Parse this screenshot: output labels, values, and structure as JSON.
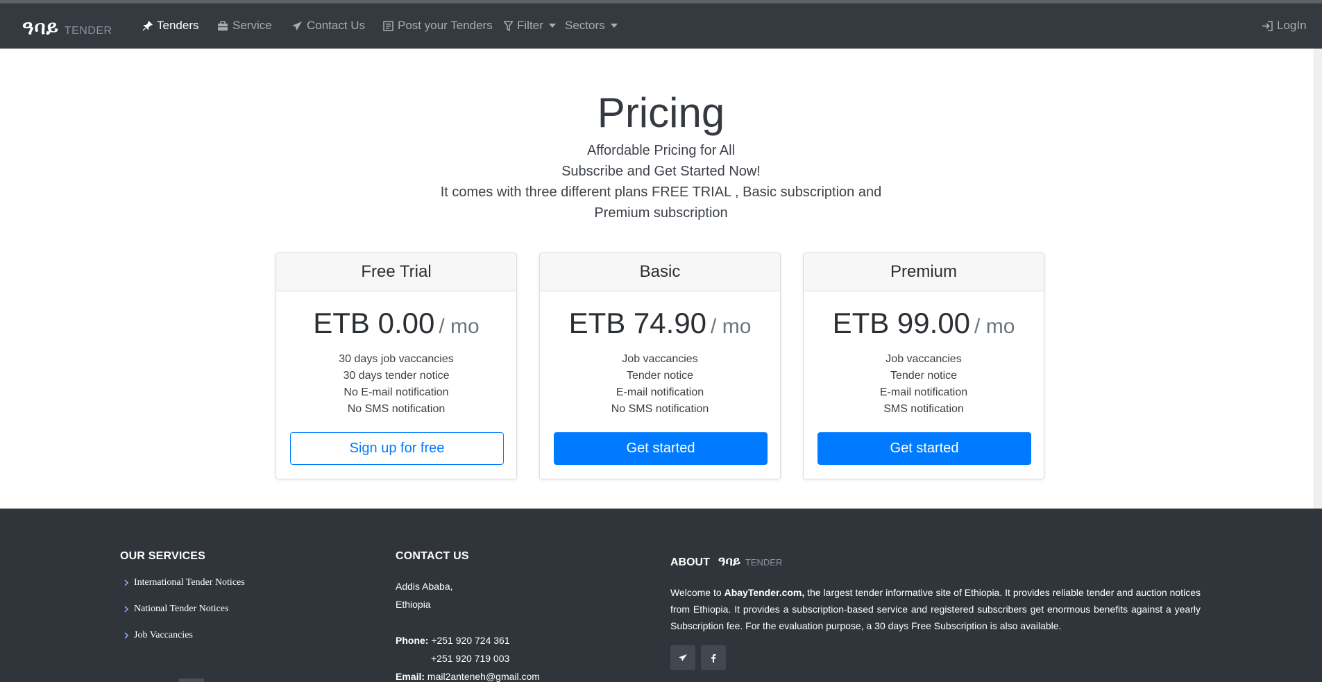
{
  "brand": {
    "mark": "ዓባይ",
    "sub": "TENDER"
  },
  "nav": {
    "items": [
      {
        "label": "Tenders",
        "icon": "pin-icon"
      },
      {
        "label": "Service",
        "icon": "briefcase-icon"
      },
      {
        "label": "Contact Us",
        "icon": "paper-plane-icon"
      },
      {
        "label": "Post your Tenders",
        "icon": "document-icon"
      },
      {
        "label": "Filter",
        "icon": "filter-icon"
      },
      {
        "label": "Sectors"
      }
    ],
    "login": "LogIn"
  },
  "hero": {
    "title": "Pricing",
    "lines": [
      "Affordable Pricing for All",
      "Subscribe and Get Started Now!",
      "It comes with three different plans FREE TRIAL , Basic subscription and",
      "Premium subscription"
    ]
  },
  "plans": [
    {
      "name": "Free Trial",
      "price": "ETB 0.00",
      "period": "/ mo",
      "features": [
        "30 days job vaccancies",
        "30 days tender notice",
        "No E-mail notification",
        "No SMS notification"
      ],
      "button": "Sign up for free"
    },
    {
      "name": "Basic",
      "price": "ETB 74.90",
      "period": "/ mo",
      "features": [
        "Job vaccancies",
        "Tender notice",
        "E-mail notification",
        "No SMS notification"
      ],
      "button": "Get started"
    },
    {
      "name": "Premium",
      "price": "ETB 99.00",
      "period": "/ mo",
      "features": [
        "Job vaccancies",
        "Tender notice",
        "E-mail notification",
        "SMS notification"
      ],
      "button": "Get started"
    }
  ],
  "footer": {
    "services": {
      "heading": "OUR SERVICES",
      "items": [
        "International Tender Notices",
        "National Tender Notices",
        "Job Vaccancies"
      ]
    },
    "contact": {
      "heading": "CONTACT US",
      "address1": "Addis Ababa,",
      "address2": "Ethiopia",
      "phone_label": "Phone:",
      "phone1": "+251 920 724 361",
      "phone2": "+251 920 719 003",
      "email_label": "Email:",
      "email": "mail2anteneh@gmail.com"
    },
    "about": {
      "heading": "ABOUT",
      "mark": "ዓባይ",
      "sub": "TENDER",
      "intro": "Welcome to ",
      "site": "AbayTender.com,",
      "text": " the largest tender informative site of Ethiopia. It provides reliable tender and auction notices from Ethiopia. It provides a subscription-based service and registered subscribers get enormous benefits against a yearly Subscription fee. For the evaluation purpose, a 30 days Free Subscription is also available."
    },
    "social": [
      "telegram-icon",
      "facebook-icon"
    ]
  },
  "colors": {
    "navbar": "#343a40",
    "footer": "#2f353b",
    "primary": "#007bff"
  }
}
